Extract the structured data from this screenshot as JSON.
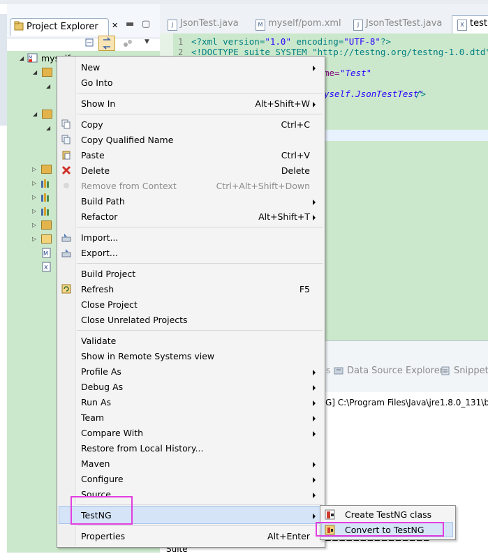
{
  "project_explorer": {
    "title": "Project Explorer",
    "project_name": "myself"
  },
  "editor": {
    "tabs": [
      "JsonTest.java",
      "myself/pom.xml",
      "JsonTestTest.java",
      "testr"
    ],
    "lines": [
      {
        "num": "1",
        "parts": [
          [
            "<?xml version=",
            "#008080"
          ],
          [
            "\"1.0\"",
            "#2a00ff"
          ],
          [
            " encoding=",
            "#008080"
          ],
          [
            "\"UTF-8\"",
            "#2a00ff"
          ],
          [
            "?>",
            "#008080"
          ]
        ]
      },
      {
        "num": "2",
        "parts": [
          [
            "<!DOCTYPE suite SYSTEM \"http://testng.org/testng-1.0.dtd\">",
            "#008080"
          ]
        ]
      }
    ],
    "visible_fragments": {
      "name_attr": "me=",
      "name_value": "\"Test\"",
      "class_value": "yself.JsonTestTest\"",
      "class_close": "/>"
    }
  },
  "bottom": {
    "tabs": [
      "Data Source Explorer",
      "Snippets"
    ],
    "console_line": "G] C:\\Program Files\\Java\\jre1.8.0_131\\bi",
    "console_separator": "===============",
    "console_suite": "Suite"
  },
  "context_menu": {
    "items": [
      {
        "label": "New",
        "shortcut": "",
        "submenu": true
      },
      {
        "label": "Go Into",
        "shortcut": "",
        "submenu": false
      },
      {
        "label": "Show In",
        "shortcut": "Alt+Shift+W",
        "submenu": true
      },
      {
        "label": "Copy",
        "shortcut": "Ctrl+C",
        "submenu": false
      },
      {
        "label": "Copy Qualified Name",
        "shortcut": "",
        "submenu": false
      },
      {
        "label": "Paste",
        "shortcut": "Ctrl+V",
        "submenu": false
      },
      {
        "label": "Delete",
        "shortcut": "Delete",
        "submenu": false
      },
      {
        "label": "Remove from Context",
        "shortcut": "Ctrl+Alt+Shift+Down",
        "submenu": false,
        "disabled": true
      },
      {
        "label": "Build Path",
        "shortcut": "",
        "submenu": true
      },
      {
        "label": "Refactor",
        "shortcut": "Alt+Shift+T",
        "submenu": true
      },
      {
        "label": "Import...",
        "shortcut": "",
        "submenu": false
      },
      {
        "label": "Export...",
        "shortcut": "",
        "submenu": false
      },
      {
        "label": "Build Project",
        "shortcut": "",
        "submenu": false
      },
      {
        "label": "Refresh",
        "shortcut": "F5",
        "submenu": false
      },
      {
        "label": "Close Project",
        "shortcut": "",
        "submenu": false
      },
      {
        "label": "Close Unrelated Projects",
        "shortcut": "",
        "submenu": false
      },
      {
        "label": "Validate",
        "shortcut": "",
        "submenu": false
      },
      {
        "label": "Show in Remote Systems view",
        "shortcut": "",
        "submenu": false
      },
      {
        "label": "Profile As",
        "shortcut": "",
        "submenu": true
      },
      {
        "label": "Debug As",
        "shortcut": "",
        "submenu": true
      },
      {
        "label": "Run As",
        "shortcut": "",
        "submenu": true
      },
      {
        "label": "Team",
        "shortcut": "",
        "submenu": true
      },
      {
        "label": "Compare With",
        "shortcut": "",
        "submenu": true
      },
      {
        "label": "Restore from Local History...",
        "shortcut": "",
        "submenu": false
      },
      {
        "label": "Maven",
        "shortcut": "",
        "submenu": true
      },
      {
        "label": "Configure",
        "shortcut": "",
        "submenu": true
      },
      {
        "label": "Source",
        "shortcut": "",
        "submenu": true
      },
      {
        "label": "TestNG",
        "shortcut": "",
        "submenu": true,
        "highlighted": true
      },
      {
        "label": "Properties",
        "shortcut": "Alt+Enter",
        "submenu": false
      }
    ]
  },
  "testng_submenu": {
    "items": [
      {
        "label": "Create TestNG class"
      },
      {
        "label": "Convert to TestNG",
        "highlighted": true
      }
    ]
  },
  "colors": {
    "tree_bg": "#cce8cc",
    "menu_bg": "#f4f4f4",
    "highlight": "#d5e5f7",
    "annotation_box": "#e23ee0"
  }
}
